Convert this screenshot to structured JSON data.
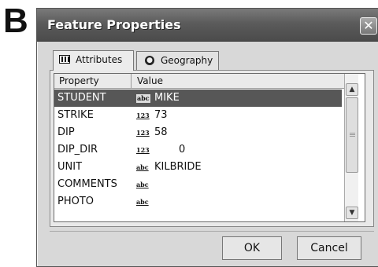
{
  "panel_label": "B",
  "window": {
    "title": "Feature Properties",
    "close_glyph": "✕",
    "icon": "document-icon"
  },
  "tabs": [
    {
      "label": "Attributes",
      "icon": "table-icon",
      "active": true
    },
    {
      "label": "Geography",
      "icon": "globe-icon",
      "active": false
    }
  ],
  "grid": {
    "columns": [
      "Property",
      "Value"
    ],
    "rows": [
      {
        "property": "STUDENT",
        "type": "abc",
        "value": "MIKE",
        "selected": true
      },
      {
        "property": "STRIKE",
        "type": "123",
        "value": "73",
        "selected": false
      },
      {
        "property": "DIP",
        "type": "123",
        "value": "58",
        "selected": false
      },
      {
        "property": "DIP_DIR",
        "type": "123",
        "value": "0",
        "selected": false
      },
      {
        "property": "UNIT",
        "type": "abc",
        "value": "KILBRIDE",
        "selected": false
      },
      {
        "property": "COMMENTS",
        "type": "abc",
        "value": "",
        "selected": false
      },
      {
        "property": "PHOTO",
        "type": "abc",
        "value": "",
        "selected": false
      }
    ],
    "scroll_up_glyph": "▲",
    "scroll_down_glyph": "▼"
  },
  "buttons": {
    "ok": "OK",
    "cancel": "Cancel"
  },
  "colors": {
    "titlebar": "#5b5b5b",
    "selected_row": "#575757",
    "window_bg": "#d8d8d8"
  }
}
